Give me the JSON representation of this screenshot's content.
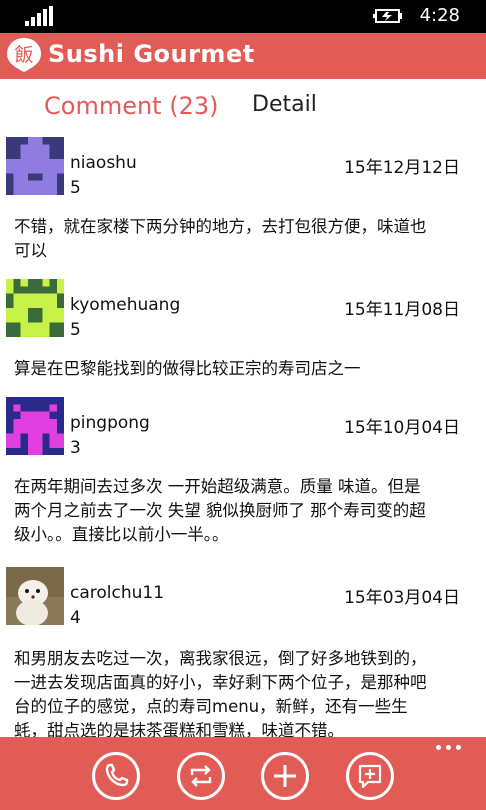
{
  "status_bar": {
    "time": "4:28"
  },
  "header": {
    "title": "Sushi Gourmet",
    "logo_glyph": "飯"
  },
  "tabs": [
    {
      "label": "Comment (23)",
      "active": true
    },
    {
      "label": "Detail",
      "active": false
    }
  ],
  "comments": [
    {
      "user": "niaoshu",
      "date": "2015年12月12日",
      "rating": "5",
      "lines": [
        "不错，就在家楼下两分钟的地方，去打包很方便，味道也",
        "可以"
      ]
    },
    {
      "user": "kyomehuang",
      "date": "2015年11月08日",
      "rating": "5",
      "lines": [
        "算是在巴黎能找到的做得比较正宗的寿司店之一"
      ]
    },
    {
      "user": "pingpong",
      "date": "2015年10月04日",
      "rating": "3",
      "lines": [
        "在两年期间去过多次 一开始超级满意。质量 味道。但是",
        "两个月之前去了一次 失望 貌似换厨师了 那个寿司变的超",
        "级小。。直接比以前小一半。。"
      ]
    },
    {
      "user": "carolchu11",
      "date": "2015年03月04日",
      "rating": "4",
      "lines": [
        "和男朋友去吃过一次，离我家很远，倒了好多地铁到的，",
        "一进去发现店面真的好小，幸好剩下两个位子，是那种吧",
        "台的位子的感觉，点的寿司menu，新鲜，还有一些生",
        "蚝，甜点选的是抹茶蛋糕和雪糕，味道不错。"
      ]
    }
  ],
  "app_bar": {
    "buttons": [
      "phone-icon",
      "refresh-icon",
      "add-icon",
      "comment-icon"
    ]
  },
  "colors": {
    "accent": "#e15c57"
  }
}
